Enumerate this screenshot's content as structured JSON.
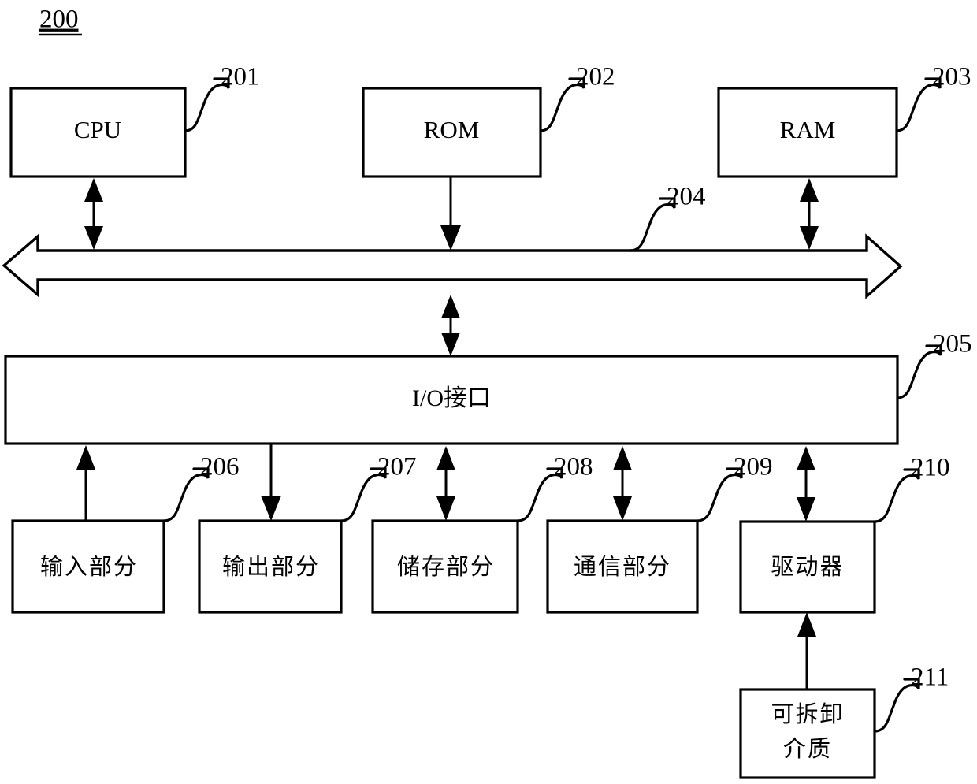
{
  "figure": {
    "number": "200",
    "type": "patent-block-diagram",
    "description": "Computer system architecture block diagram"
  },
  "blocks": {
    "cpu": {
      "label": "CPU",
      "ref": "201"
    },
    "rom": {
      "label": "ROM",
      "ref": "202"
    },
    "ram": {
      "label": "RAM",
      "ref": "203"
    },
    "bus": {
      "label": "",
      "ref": "204"
    },
    "io_interface": {
      "label": "I/O接口",
      "ref": "205"
    },
    "input": {
      "label": "输入部分",
      "ref": "206"
    },
    "output": {
      "label": "输出部分",
      "ref": "207"
    },
    "storage": {
      "label": "储存部分",
      "ref": "208"
    },
    "communication": {
      "label": "通信部分",
      "ref": "209"
    },
    "driver": {
      "label": "驱动器",
      "ref": "210"
    },
    "removable_media": {
      "label_line1": "可拆卸",
      "label_line2": "介质",
      "ref": "211"
    }
  },
  "connections": [
    {
      "from": "cpu",
      "to": "bus",
      "arrow": "bidirectional"
    },
    {
      "from": "rom",
      "to": "bus",
      "arrow": "down"
    },
    {
      "from": "ram",
      "to": "bus",
      "arrow": "bidirectional"
    },
    {
      "from": "bus",
      "to": "io_interface",
      "arrow": "bidirectional"
    },
    {
      "from": "input",
      "to": "io_interface",
      "arrow": "up"
    },
    {
      "from": "io_interface",
      "to": "output",
      "arrow": "down"
    },
    {
      "from": "io_interface",
      "to": "storage",
      "arrow": "bidirectional"
    },
    {
      "from": "io_interface",
      "to": "communication",
      "arrow": "bidirectional"
    },
    {
      "from": "io_interface",
      "to": "driver",
      "arrow": "bidirectional"
    },
    {
      "from": "removable_media",
      "to": "driver",
      "arrow": "up"
    }
  ],
  "colors": {
    "stroke": "#000000",
    "fill": "#ffffff",
    "background": "#ffffff"
  }
}
